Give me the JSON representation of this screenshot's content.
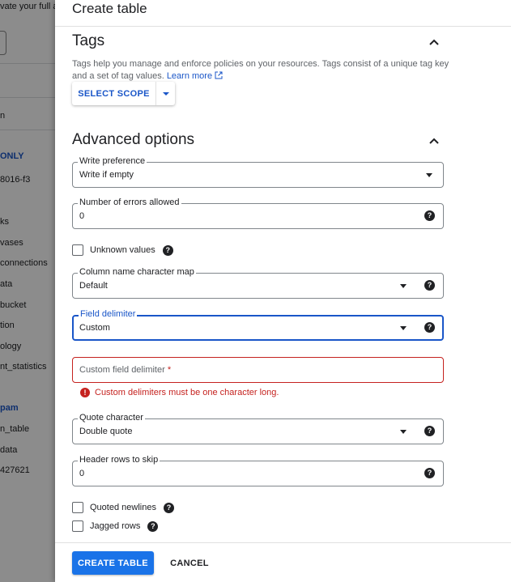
{
  "background": {
    "items": [
      {
        "text": "vate your full a"
      },
      {
        "text": "n"
      },
      {
        "text": "ONLY"
      },
      {
        "text": "8016-f3"
      },
      {
        "text": "ks"
      },
      {
        "text": "vases"
      },
      {
        "text": "connections"
      },
      {
        "text": "ata"
      },
      {
        "text": "bucket"
      },
      {
        "text": "tion"
      },
      {
        "text": "ology"
      },
      {
        "text": "nt_statistics"
      },
      {
        "text": "pam"
      },
      {
        "text": "n_table"
      },
      {
        "text": "data"
      },
      {
        "text": "427621"
      }
    ]
  },
  "panel": {
    "title": "Create table"
  },
  "tags": {
    "title": "Tags",
    "description": "Tags help you manage and enforce policies on your resources. Tags consist of a unique tag key and a set of tag values.",
    "learn_more": "Learn more",
    "select_scope": "SELECT SCOPE"
  },
  "advanced": {
    "title": "Advanced options",
    "write_preference": {
      "label": "Write preference",
      "value": "Write if empty"
    },
    "errors_allowed": {
      "label": "Number of errors allowed",
      "value": "0"
    },
    "unknown_values": {
      "label": "Unknown values",
      "checked": false
    },
    "column_map": {
      "label": "Column name character map",
      "value": "Default"
    },
    "field_delimiter": {
      "label": "Field delimiter",
      "value": "Custom"
    },
    "custom_delimiter": {
      "placeholder": "Custom field delimiter",
      "required": "*",
      "error": "Custom delimiters must be one character long."
    },
    "quote_character": {
      "label": "Quote character",
      "value": "Double quote"
    },
    "header_rows": {
      "label": "Header rows to skip",
      "value": "0"
    },
    "quoted_newlines": {
      "label": "Quoted newlines",
      "checked": false
    },
    "jagged_rows": {
      "label": "Jagged rows",
      "checked": false
    }
  },
  "footer": {
    "create": "CREATE TABLE",
    "cancel": "CANCEL"
  },
  "colors": {
    "primary": "#1a73e8",
    "link": "#1a56c8",
    "error": "#c5221f"
  }
}
